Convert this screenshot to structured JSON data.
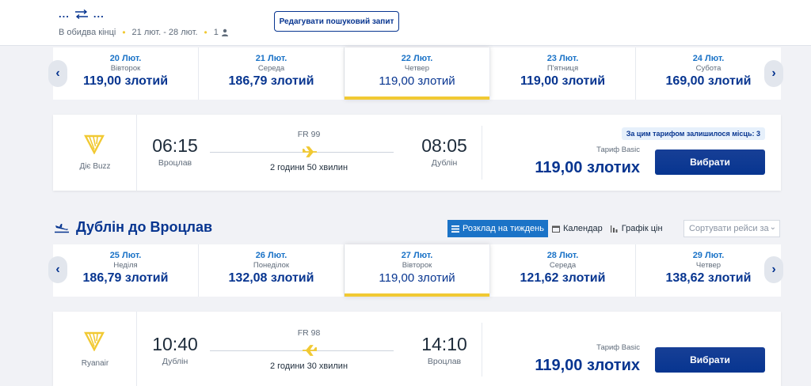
{
  "header": {
    "route_from": "...",
    "route_to": "...",
    "trip_type": "В обидва кінці",
    "dates": "21 лют. - 28 лют.",
    "passengers": "1",
    "edit_button": "Редагувати пошуковий запит",
    "icons": {
      "swap": "round-trip-arrows-icon",
      "passenger": "person-icon"
    }
  },
  "outbound": {
    "days": [
      {
        "date": "20 Лют.",
        "weekday": "Вівторок",
        "price": "119,00 злотий"
      },
      {
        "date": "21 Лют.",
        "weekday": "Середа",
        "price": "186,79 злотий"
      },
      {
        "date": "22 Лют.",
        "weekday": "Четвер",
        "price": "119,00 злотий",
        "selected": true
      },
      {
        "date": "23 Лют.",
        "weekday": "П'ятниця",
        "price": "119,00 злотий"
      },
      {
        "date": "24 Лют.",
        "weekday": "Субота",
        "price": "169,00 злотий"
      }
    ],
    "flight": {
      "airline": "Діє Buzz",
      "depart_time": "06:15",
      "depart_city": "Вроцлав",
      "flight_no": "FR 99",
      "duration": "2 години 50 хвилин",
      "arrive_time": "08:05",
      "arrive_city": "Дублін",
      "seats_left": "За цим тарифом залишилося місць: 3",
      "fare_label": "Тариф Basic",
      "fare_price": "119,00 злотих",
      "select_button": "Вибрати"
    }
  },
  "return": {
    "title": "Дублін до Вроцлав",
    "tabs": [
      {
        "label": "Розклад на тиждень",
        "icon": "list-icon",
        "active": true
      },
      {
        "label": "Календар",
        "icon": "calendar-icon"
      },
      {
        "label": "Графік цін",
        "icon": "bar-chart-icon"
      }
    ],
    "sort_placeholder": "Сортувати рейси за",
    "days": [
      {
        "date": "25 Лют.",
        "weekday": "Неділя",
        "price": "186,79 злотий"
      },
      {
        "date": "26 Лют.",
        "weekday": "Понеділок",
        "price": "132,08 злотий"
      },
      {
        "date": "27 Лют.",
        "weekday": "Вівторок",
        "price": "119,00 злотий",
        "selected": true
      },
      {
        "date": "28 Лют.",
        "weekday": "Середа",
        "price": "121,62 злотий"
      },
      {
        "date": "29 Лют.",
        "weekday": "Четвер",
        "price": "138,62 злотий"
      }
    ],
    "flight": {
      "airline": "Ryanair",
      "depart_time": "10:40",
      "depart_city": "Дублін",
      "flight_no": "FR 98",
      "duration": "2 години 30 хвилин",
      "arrive_time": "14:10",
      "arrive_city": "Вроцлав",
      "fare_label": "Тариф Basic",
      "fare_price": "119,00 злотих",
      "select_button": "Вибрати"
    }
  },
  "colors": {
    "brand": "#073590",
    "accent_yellow": "#f1c933",
    "link_blue": "#1b73c7"
  }
}
